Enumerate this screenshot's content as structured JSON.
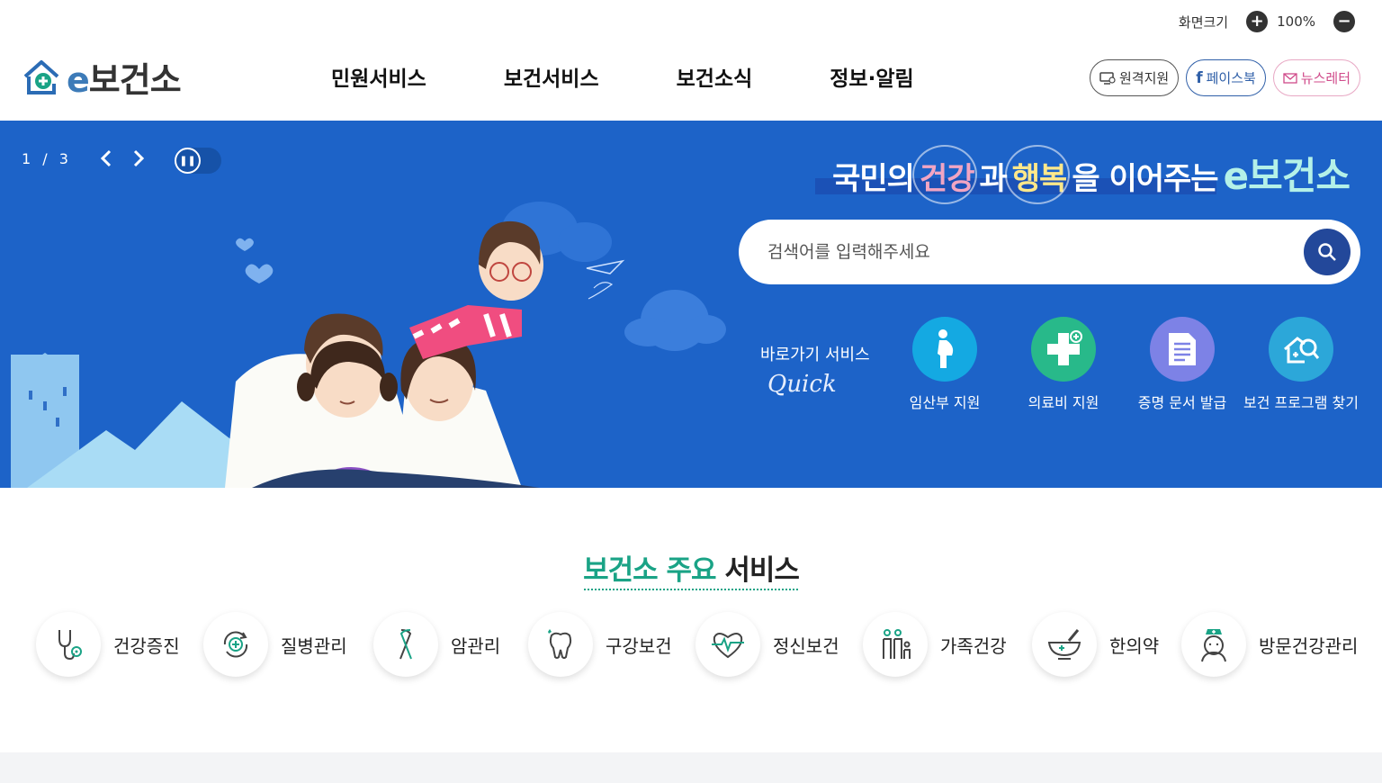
{
  "topbar": {
    "screen_size_label": "화면크기",
    "zoom_in_icon": "plus-circle-icon",
    "zoom_level": "100%",
    "zoom_out_icon": "minus-circle-icon"
  },
  "header": {
    "logo_e": "e",
    "logo_text": "보건소",
    "nav": [
      "민원서비스",
      "보건서비스",
      "보건소식",
      "정보·알림"
    ],
    "util": {
      "remote": "원격지원",
      "facebook": "페이스북",
      "newsletter": "뉴스레터"
    }
  },
  "hero": {
    "slide_current": "1",
    "slide_sep": "/",
    "slide_total": "3",
    "slogan": {
      "part1": "국민의",
      "hl1": "건강",
      "part2": "과",
      "hl2": "행복",
      "part3": "을 이어주는",
      "brand": "e보건소"
    },
    "search_placeholder": "검색어를 입력해주세요",
    "quick_title": "바로가기 서비스",
    "quick_script": "Quick",
    "quick_items": [
      {
        "label": "임산부 지원",
        "icon": "pregnant-woman-icon",
        "color": "#14a9e2"
      },
      {
        "label": "의료비 지원",
        "icon": "medical-cross-icon",
        "color": "#28b98a"
      },
      {
        "label": "증명 문서 발급",
        "icon": "document-icon",
        "color": "#7d82e6"
      },
      {
        "label": "보건 프로그램 찾기",
        "icon": "house-search-icon",
        "color": "#2ca7d9"
      }
    ]
  },
  "services": {
    "title_accent": "보건소 주요",
    "title_rest": "서비스",
    "items": [
      {
        "label": "건강증진",
        "icon": "stethoscope-icon"
      },
      {
        "label": "질병관리",
        "icon": "rotate-cross-icon"
      },
      {
        "label": "암관리",
        "icon": "ribbon-icon"
      },
      {
        "label": "구강보건",
        "icon": "tooth-icon"
      },
      {
        "label": "정신보건",
        "icon": "heart-pulse-icon"
      },
      {
        "label": "가족건강",
        "icon": "family-icon"
      },
      {
        "label": "한의약",
        "icon": "mortar-icon"
      },
      {
        "label": "방문건강관리",
        "icon": "nurse-icon"
      }
    ]
  },
  "colors": {
    "hero_bg": "#1d63c8",
    "accent_green": "#1aa386",
    "search_button": "#23489a"
  }
}
